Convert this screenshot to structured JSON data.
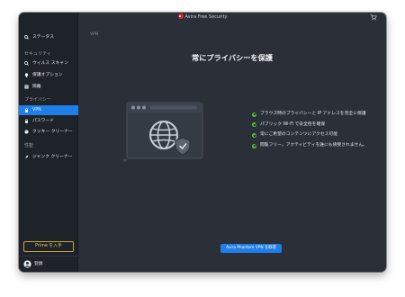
{
  "window": {
    "title": "Avira Free Security"
  },
  "sidebar": {
    "status_label": "ステータス",
    "security_heading": "セキュリティ",
    "security_items": [
      {
        "label": "ウィルス スキャン",
        "icon": "search-icon"
      },
      {
        "label": "保護オプション",
        "icon": "lightbulb-icon"
      },
      {
        "label": "隔離",
        "icon": "quarantine-box-icon"
      }
    ],
    "privacy_heading": "プライバシー",
    "privacy_items": [
      {
        "label": "VPN",
        "icon": "vpn-lock-icon",
        "active": true
      },
      {
        "label": "パスワード",
        "icon": "padlock-icon"
      },
      {
        "label": "クッキー クリーナー",
        "icon": "cookie-icon"
      }
    ],
    "performance_heading": "性能",
    "performance_items": [
      {
        "label": "ジャンク クリーナー",
        "icon": "rocket-icon"
      }
    ],
    "prime_button": "Prime を入手",
    "login_label": "登録"
  },
  "main": {
    "breadcrumb": "VPN",
    "heading": "常にプライバシーを保護",
    "features": [
      "ブラウズ時のプライバシーと IP アドレスを完全に保護",
      "パブリック Wi-Fi で安全性を確保",
      "常にご希望のコンテンツにアクセス可能",
      "閲覧フリー。アクティビティを誰にも傍受されません。"
    ],
    "cta_button": "Avira Phantom VPN を取得"
  },
  "colors": {
    "accent": "#1f7ee8",
    "check": "#56c43a",
    "prime_gold": "#c9a43a",
    "sidebar_bg": "#1e2229",
    "main_bg": "#2a2f38"
  }
}
